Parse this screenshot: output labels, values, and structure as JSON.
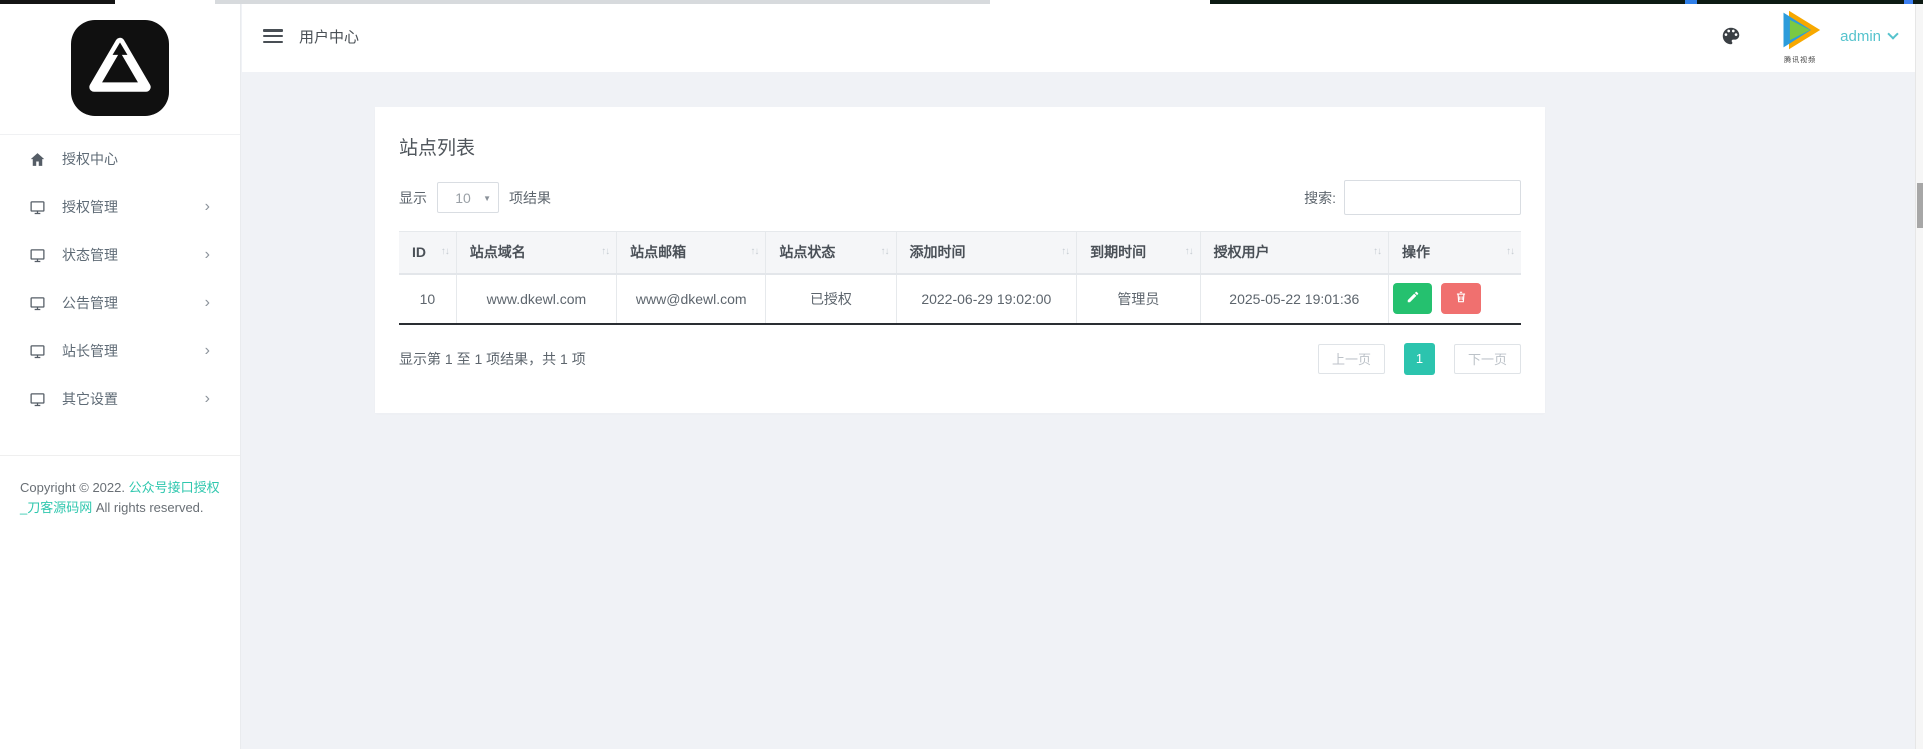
{
  "icons": {
    "sort": "↑↓",
    "chevron_right": "›",
    "select_caret": "▼"
  },
  "colors": {
    "accent_teal": "#2cc4ae",
    "link_teal": "#2fc7ae",
    "admin_teal": "#55c3cd",
    "edit_green": "#25c16f",
    "delete_red": "#f0706f"
  },
  "sidebar": {
    "items": [
      {
        "label": "授权中心",
        "icon": "home"
      },
      {
        "label": "授权管理",
        "icon": "monitor"
      },
      {
        "label": "状态管理",
        "icon": "monitor"
      },
      {
        "label": "公告管理",
        "icon": "monitor"
      },
      {
        "label": "站长管理",
        "icon": "monitor"
      },
      {
        "label": "其它设置",
        "icon": "monitor"
      }
    ],
    "copyright": {
      "prefix": "Copyright © 2022.",
      "link": "公众号接口授权_刀客源码网",
      "suffix": "All rights reserved."
    }
  },
  "header": {
    "title": "用户中心",
    "user": "admin",
    "avatar_caption": "腾讯视频"
  },
  "card": {
    "title": "站点列表",
    "length_control": {
      "prefix": "显示",
      "value": "10",
      "suffix": "项结果"
    },
    "search_label": "搜索:",
    "table": {
      "columns": [
        "ID",
        "站点域名",
        "站点邮箱",
        "站点状态",
        "添加时间",
        "到期时间",
        "授权用户",
        "操作"
      ],
      "rows": [
        [
          "10",
          "www.dkewl.com",
          "www@dkewl.com",
          "已授权",
          "2022-06-29 19:02:00",
          "管理员",
          "2025-05-22 19:01:36"
        ]
      ]
    },
    "info": "显示第 1 至 1 项结果，共 1 项",
    "pagination": {
      "prev": "上一页",
      "current": "1",
      "next": "下一页"
    }
  }
}
